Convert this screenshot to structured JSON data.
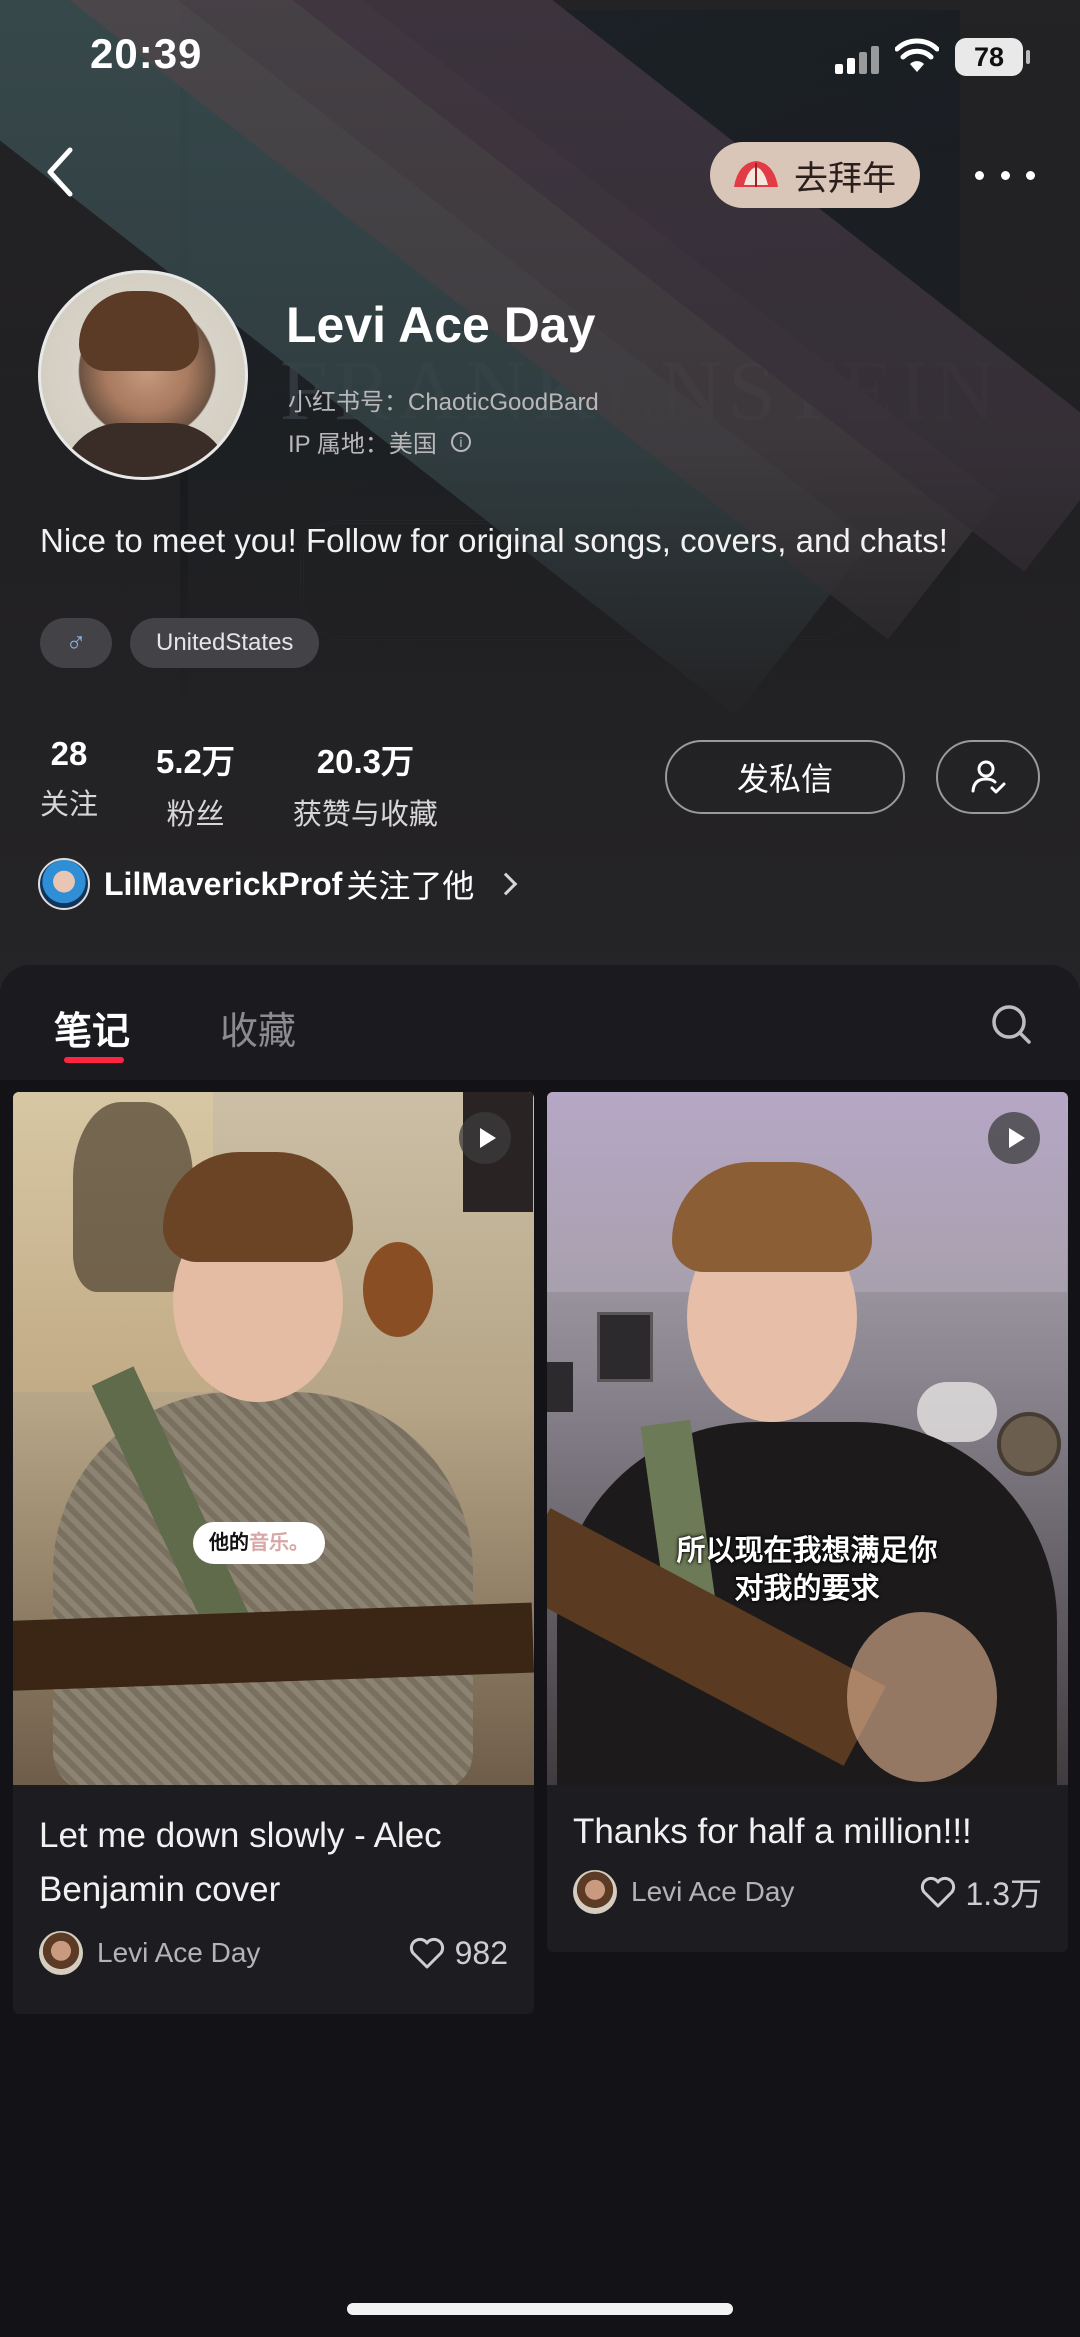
{
  "status_bar": {
    "time": "20:39",
    "battery": "78"
  },
  "nav": {
    "bainian_label": "去拜年"
  },
  "profile": {
    "name": "Levi Ace Day",
    "redbook_id": "小红书号：ChaoticGoodBard",
    "ip_location": "IP 属地：美国",
    "bio": "Nice to meet you! Follow for original songs, covers, and chats!",
    "tags": [
      {
        "label": "♂",
        "type": "gender"
      },
      {
        "label": "UnitedStates",
        "type": "location"
      }
    ],
    "stats": [
      {
        "value": "28",
        "label": "关注"
      },
      {
        "value": "5.2万",
        "label": "粉丝"
      },
      {
        "value": "20.3万",
        "label": "获赞与收藏"
      }
    ],
    "dm_button": "发私信",
    "followed_by": {
      "name": "LilMaverickProf",
      "text": "关注了他"
    }
  },
  "tabs": [
    {
      "label": "笔记",
      "active": true
    },
    {
      "label": "收藏",
      "active": false
    }
  ],
  "accent_color": "#ff2442",
  "notes": [
    {
      "title": "Let me down slowly - Alec Benjamin cover",
      "author": "Levi Ace Day",
      "likes": "982",
      "video_caption_a": "他的",
      "video_caption_b": "音乐。"
    },
    {
      "title": "Thanks for half a million!!!",
      "author": "Levi Ace Day",
      "likes": "1.3万",
      "subtitle": "所以现在我想满足你对我的要求"
    }
  ]
}
